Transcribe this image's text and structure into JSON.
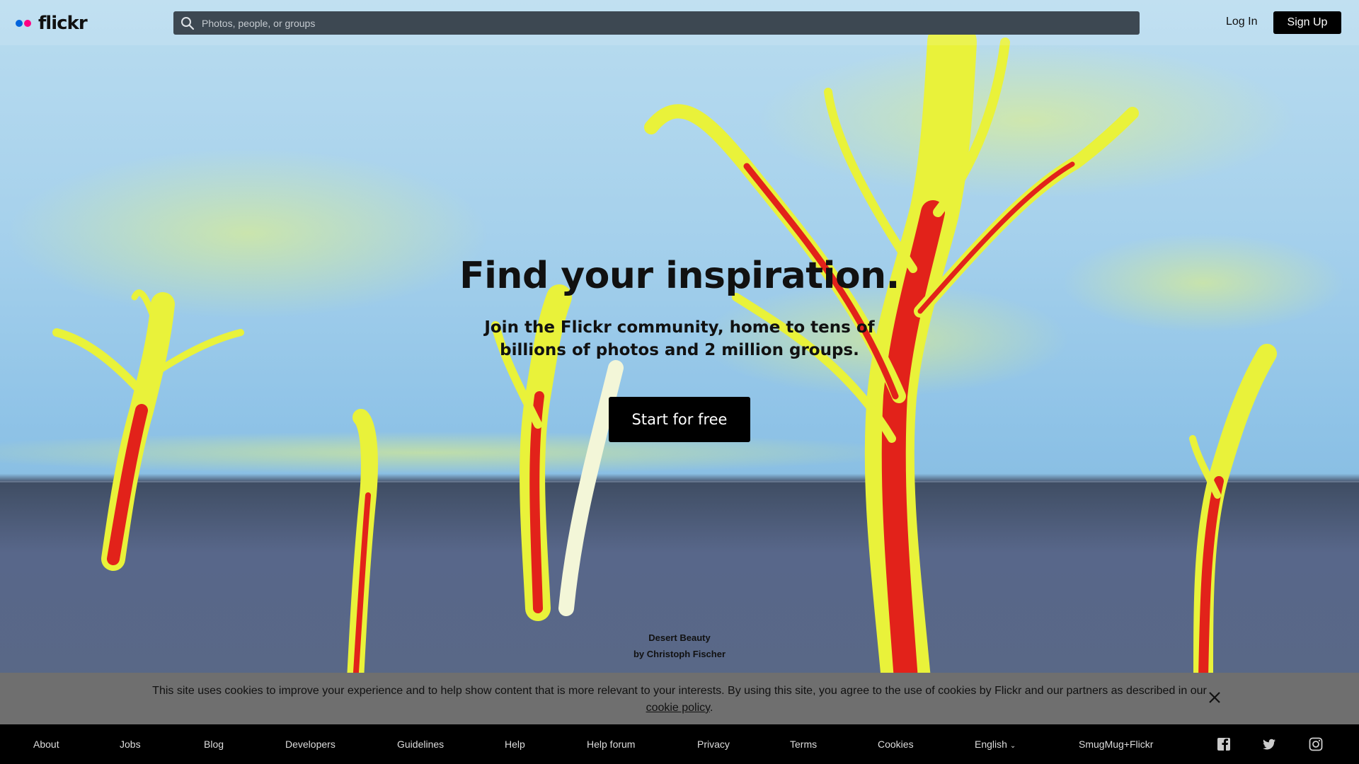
{
  "brand": {
    "name": "flickr",
    "dot_blue": "#0063dc",
    "dot_pink": "#ff0084"
  },
  "header": {
    "search_placeholder": "Photos, people, or groups",
    "login_label": "Log In",
    "signup_label": "Sign Up"
  },
  "hero": {
    "headline": "Find your inspiration.",
    "subline": "Join the Flickr community, home to tens of billions of photos and 2 million groups.",
    "cta_label": "Start for free",
    "photo_title": "Desert Beauty",
    "photo_credit": "by Christoph Fischer"
  },
  "cookie": {
    "text": "This site uses cookies to improve your experience and to help show content that is more relevant to your interests. By using this site, you agree to the use of cookies by Flickr and our partners as described in our",
    "link_label": "cookie policy",
    "suffix": "."
  },
  "footer": {
    "links": [
      "About",
      "Jobs",
      "Blog",
      "Developers",
      "Guidelines",
      "Help",
      "Help forum",
      "Privacy",
      "Terms",
      "Cookies",
      "English",
      "SmugMug+Flickr"
    ],
    "social": [
      "facebook-icon",
      "twitter-icon",
      "instagram-icon"
    ]
  }
}
